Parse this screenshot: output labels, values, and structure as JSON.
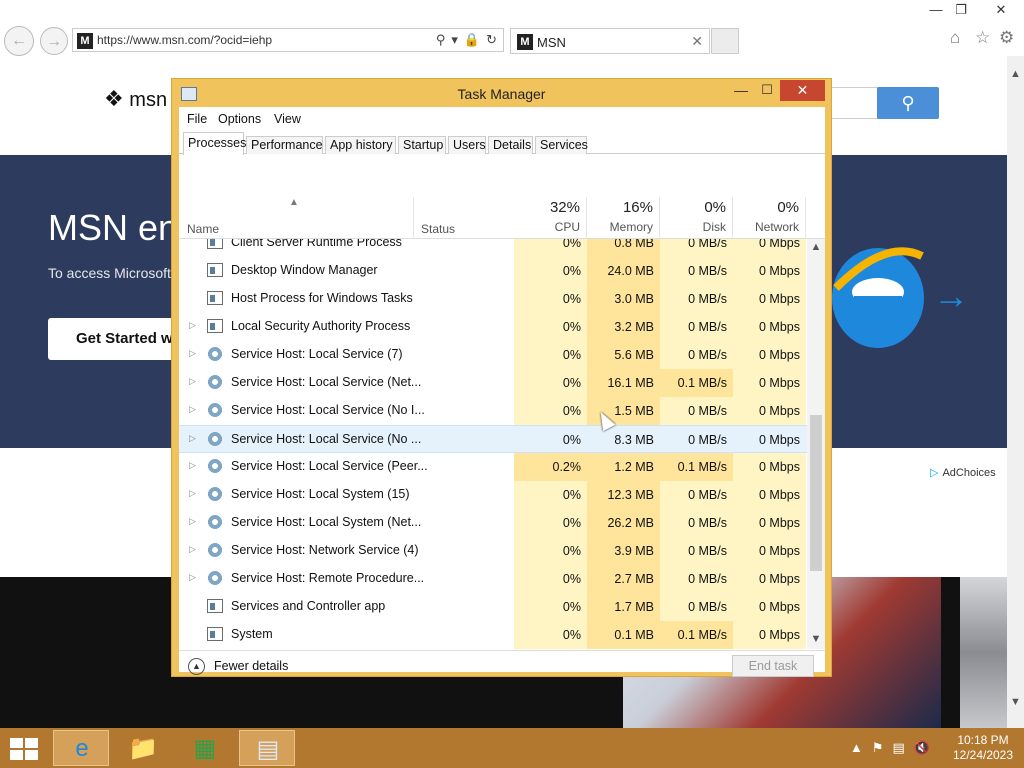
{
  "ie": {
    "address": "https://www.msn.com/?ocid=iehp",
    "tab_label": "MSN",
    "favicon_letter": "M",
    "win_min": "—",
    "win_max": "❐",
    "win_close": "✕",
    "tab_close": "✕"
  },
  "msn": {
    "logo_text": "msn",
    "banner_heading": "MSN en",
    "banner_sub": "To access Microsoft S",
    "cta_label": "Get Started wi",
    "adchoices": "AdChoices"
  },
  "task_manager": {
    "title": "Task Manager",
    "menu": [
      "File",
      "Options",
      "View"
    ],
    "tabs": [
      "Processes",
      "Performance",
      "App history",
      "Startup",
      "Users",
      "Details",
      "Services"
    ],
    "active_tab": "Processes",
    "columns": {
      "name": "Name",
      "status": "Status",
      "cpu": {
        "pct": "32%",
        "label": "CPU"
      },
      "memory": {
        "pct": "16%",
        "label": "Memory"
      },
      "disk": {
        "pct": "0%",
        "label": "Disk"
      },
      "network": {
        "pct": "0%",
        "label": "Network"
      }
    },
    "rows": [
      {
        "name": "Client Server Runtime Process",
        "expand": false,
        "icon": "window",
        "cpu": "0%",
        "mem": "0.8 MB",
        "disk": "0 MB/s",
        "net": "0 Mbps"
      },
      {
        "name": "Desktop Window Manager",
        "expand": false,
        "icon": "window",
        "cpu": "0%",
        "mem": "24.0 MB",
        "disk": "0 MB/s",
        "net": "0 Mbps"
      },
      {
        "name": "Host Process for Windows Tasks",
        "expand": false,
        "icon": "window",
        "cpu": "0%",
        "mem": "3.0 MB",
        "disk": "0 MB/s",
        "net": "0 Mbps"
      },
      {
        "name": "Local Security Authority Process",
        "expand": true,
        "icon": "window",
        "cpu": "0%",
        "mem": "3.2 MB",
        "disk": "0 MB/s",
        "net": "0 Mbps"
      },
      {
        "name": "Service Host: Local Service (7)",
        "expand": true,
        "icon": "gear",
        "cpu": "0%",
        "mem": "5.6 MB",
        "disk": "0 MB/s",
        "net": "0 Mbps"
      },
      {
        "name": "Service Host: Local Service (Net...",
        "expand": true,
        "icon": "gear",
        "cpu": "0%",
        "mem": "16.1 MB",
        "disk": "0.1 MB/s",
        "net": "0 Mbps"
      },
      {
        "name": "Service Host: Local Service (No I...",
        "expand": true,
        "icon": "gear",
        "cpu": "0%",
        "mem": "1.5 MB",
        "disk": "0 MB/s",
        "net": "0 Mbps"
      },
      {
        "name": "Service Host: Local Service (No ...",
        "expand": true,
        "icon": "gear",
        "cpu": "0%",
        "mem": "8.3 MB",
        "disk": "0 MB/s",
        "net": "0 Mbps",
        "selected": true
      },
      {
        "name": "Service Host: Local Service (Peer...",
        "expand": true,
        "icon": "gear",
        "cpu": "0.2%",
        "mem": "1.2 MB",
        "disk": "0.1 MB/s",
        "net": "0 Mbps"
      },
      {
        "name": "Service Host: Local System (15)",
        "expand": true,
        "icon": "gear",
        "cpu": "0%",
        "mem": "12.3 MB",
        "disk": "0 MB/s",
        "net": "0 Mbps"
      },
      {
        "name": "Service Host: Local System (Net...",
        "expand": true,
        "icon": "gear",
        "cpu": "0%",
        "mem": "26.2 MB",
        "disk": "0 MB/s",
        "net": "0 Mbps"
      },
      {
        "name": "Service Host: Network Service (4)",
        "expand": true,
        "icon": "gear",
        "cpu": "0%",
        "mem": "3.9 MB",
        "disk": "0 MB/s",
        "net": "0 Mbps"
      },
      {
        "name": "Service Host: Remote Procedure...",
        "expand": true,
        "icon": "gear",
        "cpu": "0%",
        "mem": "2.7 MB",
        "disk": "0 MB/s",
        "net": "0 Mbps"
      },
      {
        "name": "Services and Controller app",
        "expand": false,
        "icon": "window",
        "cpu": "0%",
        "mem": "1.7 MB",
        "disk": "0 MB/s",
        "net": "0 Mbps"
      },
      {
        "name": "System",
        "expand": false,
        "icon": "window",
        "cpu": "0%",
        "mem": "0.1 MB",
        "disk": "0.1 MB/s",
        "net": "0 Mbps"
      }
    ],
    "fewer_details": "Fewer details",
    "end_task": "End task",
    "min_glyph": "—",
    "max_glyph": "☐",
    "close_glyph": "✕"
  },
  "taskbar": {
    "time": "10:18 PM",
    "date": "12/24/2023"
  }
}
